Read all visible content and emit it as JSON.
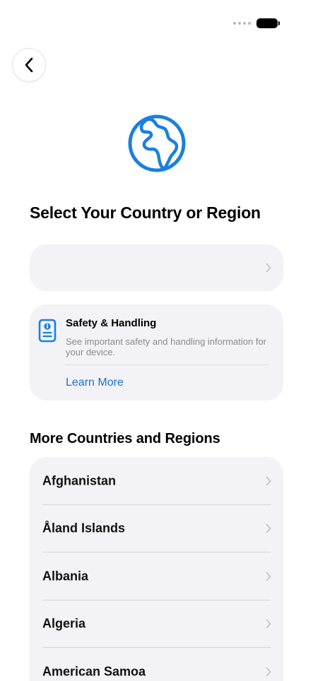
{
  "status": {
    "signal_icon": "signal-dots-icon",
    "battery_icon": "battery-icon"
  },
  "header": {
    "back_icon": "chevron-left-icon",
    "hero_icon": "globe-icon",
    "title": "Select Your Country or Region"
  },
  "suggested": {
    "label": ""
  },
  "safety": {
    "icon": "document-info-icon",
    "title": "Safety & Handling",
    "description": "See important safety and handling information for your device.",
    "link": "Learn More"
  },
  "more": {
    "title": "More Countries and Regions",
    "countries": [
      {
        "name": "Afghanistan"
      },
      {
        "name": "Åland Islands"
      },
      {
        "name": "Albania"
      },
      {
        "name": "Algeria"
      },
      {
        "name": "American Samoa"
      }
    ]
  },
  "colors": {
    "accent": "#1a7fe0",
    "link": "#1a73c8",
    "card_bg": "#f2f2f7",
    "secondary_text": "#8a8a8e"
  }
}
